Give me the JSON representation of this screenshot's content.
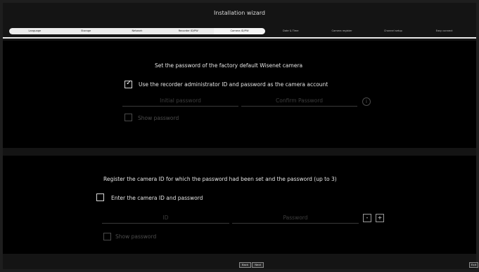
{
  "window": {
    "title": "Installation wizard"
  },
  "steps": [
    {
      "label": "Language",
      "state": "done"
    },
    {
      "label": "Storage",
      "state": "done"
    },
    {
      "label": "Network",
      "state": "done"
    },
    {
      "label": "Recorder ID/PW",
      "state": "done"
    },
    {
      "label": "Camera ID/PW",
      "state": "active"
    },
    {
      "label": "Date & Time",
      "state": "pending"
    },
    {
      "label": "Camera register",
      "state": "pending"
    },
    {
      "label": "Channel setup",
      "state": "pending"
    },
    {
      "label": "Easy connect",
      "state": "pending"
    }
  ],
  "factory_section": {
    "heading": "Set the password of the factory default Wisenet camera",
    "use_recorder_checkbox": {
      "label": "Use the recorder administrator ID and password as the camera account",
      "checked": true
    },
    "initial_password_placeholder": "Initial password",
    "confirm_password_placeholder": "Confirm Password",
    "info_icon": "info-icon",
    "show_password": {
      "label": "Show password",
      "checked": false,
      "enabled": false
    }
  },
  "register_section": {
    "heading": "Register the camera ID for which the password had been set and the password (up to 3)",
    "enter_checkbox": {
      "label": "Enter the camera ID and password",
      "checked": false
    },
    "id_placeholder": "ID",
    "password_placeholder": "Password",
    "minus_label": "-",
    "plus_label": "+",
    "show_password": {
      "label": "Show password",
      "checked": false,
      "enabled": false
    }
  },
  "footer": {
    "back_label": "Back",
    "next_label": "Next",
    "exit_label": "Exit"
  },
  "colors": {
    "background": "#000000",
    "panel": "#141414",
    "text": "#e6e6e6",
    "disabled": "#4d4d4d",
    "step_done": "#ececec"
  }
}
